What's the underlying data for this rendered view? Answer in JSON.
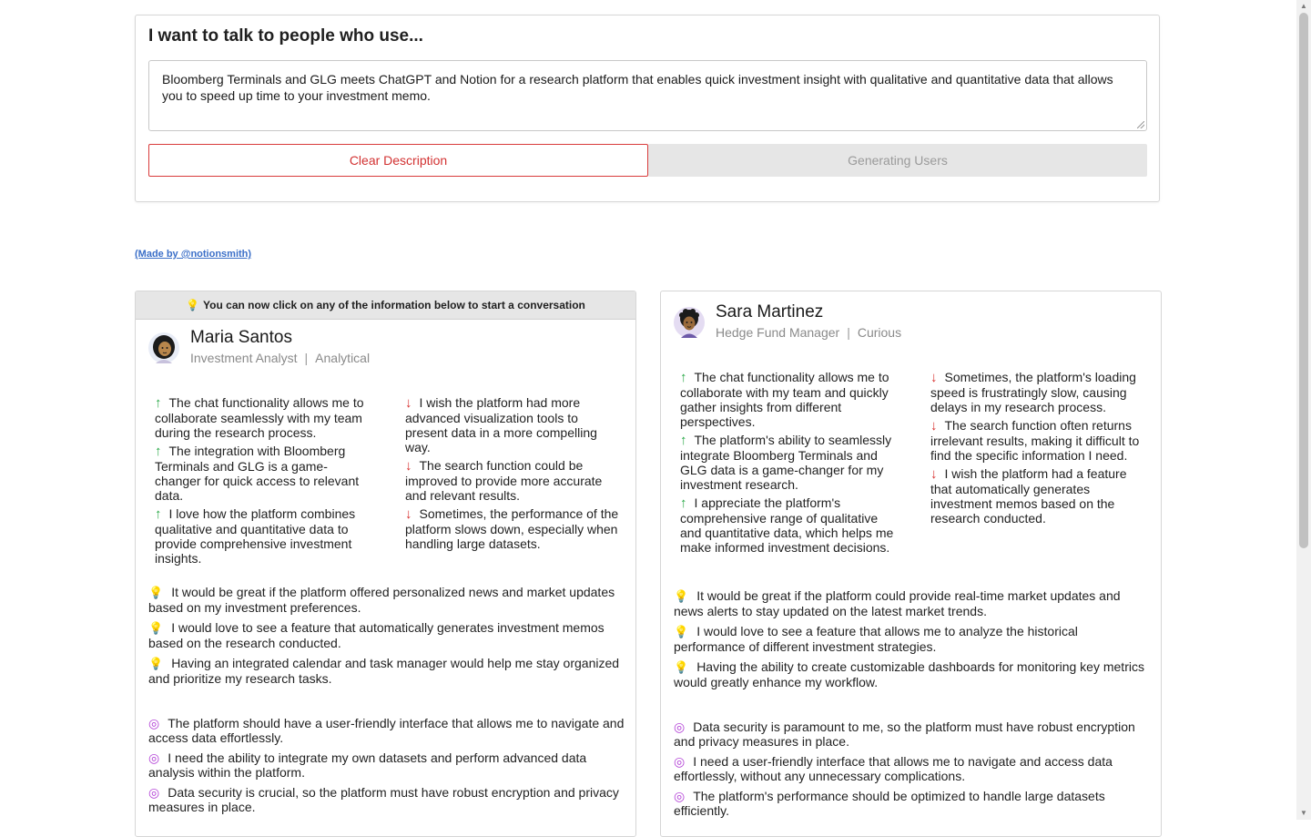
{
  "prompt": {
    "heading": "I want to talk to people who use...",
    "description": "Bloomberg Terminals and GLG meets ChatGPT and Notion for a research platform that enables quick investment insight with qualitative and quantitative data that allows you to speed up time to your investment memo.",
    "clear_label": "Clear Description",
    "generating_label": "Generating Users"
  },
  "made_by": "(Made by @notionsmith)",
  "hint": "You can now click on any of the information below to start a conversation",
  "personas": [
    {
      "name": "Maria Santos",
      "role": "Investment Analyst",
      "trait": "Analytical",
      "pros": [
        "The chat functionality allows me to collaborate seamlessly with my team during the research process.",
        "The integration with Bloomberg Terminals and GLG is a game-changer for quick access to relevant data.",
        "I love how the platform combines qualitative and quantitative data to provide comprehensive investment insights."
      ],
      "cons": [
        "I wish the platform had more advanced visualization tools to present data in a more compelling way.",
        "The search function could be improved to provide more accurate and relevant results.",
        "Sometimes, the performance of the platform slows down, especially when handling large datasets."
      ],
      "ideas": [
        "It would be great if the platform offered personalized news and market updates based on my investment preferences.",
        "I would love to see a feature that automatically generates investment memos based on the research conducted.",
        "Having an integrated calendar and task manager would help me stay organized and prioritize my research tasks."
      ],
      "needs": [
        "The platform should have a user-friendly interface that allows me to navigate and access data effortlessly.",
        "I need the ability to integrate my own datasets and perform advanced data analysis within the platform.",
        "Data security is crucial, so the platform must have robust encryption and privacy measures in place."
      ]
    },
    {
      "name": "Sara Martinez",
      "role": "Hedge Fund Manager",
      "trait": "Curious",
      "pros": [
        "The chat functionality allows me to collaborate with my team and quickly gather insights from different perspectives.",
        "The platform's ability to seamlessly integrate Bloomberg Terminals and GLG data is a game-changer for my investment research.",
        "I appreciate the platform's comprehensive range of qualitative and quantitative data, which helps me make informed investment decisions."
      ],
      "cons": [
        "Sometimes, the platform's loading speed is frustratingly slow, causing delays in my research process.",
        "The search function often returns irrelevant results, making it difficult to find the specific information I need.",
        "I wish the platform had a feature that automatically generates investment memos based on the research conducted."
      ],
      "ideas": [
        "It would be great if the platform could provide real-time market updates and news alerts to stay updated on the latest market trends.",
        "I would love to see a feature that allows me to analyze the historical performance of different investment strategies.",
        "Having the ability to create customizable dashboards for monitoring key metrics would greatly enhance my workflow."
      ],
      "needs": [
        "Data security is paramount to me, so the platform must have robust encryption and privacy measures in place.",
        "I need a user-friendly interface that allows me to navigate and access data effortlessly, without any unnecessary complications.",
        "The platform's performance should be optimized to handle large datasets efficiently."
      ]
    }
  ],
  "icons": {
    "pro": "arrow-up-icon",
    "con": "arrow-down-icon",
    "idea": "lightbulb-icon",
    "need": "target-icon"
  },
  "colors": {
    "pro": "#27a745",
    "con": "#d8312f",
    "idea": "#f2b600",
    "need": "#b23fd6",
    "clear_button": "#d93b3b",
    "link": "#3b6fc8"
  }
}
